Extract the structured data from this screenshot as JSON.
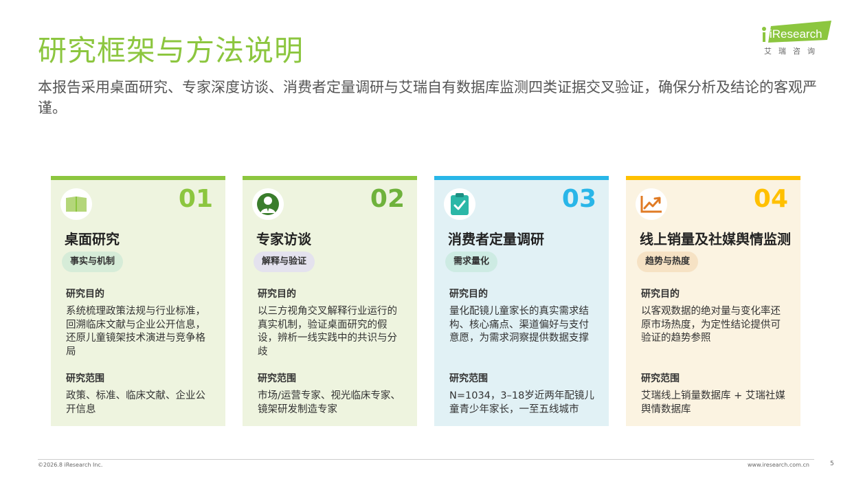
{
  "header": {
    "title": "研究框架与方法说明",
    "subtitle": "本报告采用桌面研究、专家深度访谈、消费者定量调研与艾瑞自有数据库监测四类证据交叉验证，确保分析及结论的客观严谨。"
  },
  "logo": {
    "brand_text": "iResearch",
    "cn_text": "艾瑞咨询",
    "color": "#8cc63f"
  },
  "cards": [
    {
      "number": "01",
      "title": "桌面研究",
      "tag": "事实与机制",
      "icon": "book-icon",
      "accent": "#8cc63f",
      "bg": "#eef4df",
      "tag_bg": "#d6ecd8",
      "purpose_label": "研究目的",
      "purpose": "系统梳理政策法规与行业标准，回溯临床文献与企业公开信息，还原儿童镜架技术演进与竞争格局",
      "scope_label": "研究范围",
      "scope": "政策、标准、临床文献、企业公开信息"
    },
    {
      "number": "02",
      "title": "专家访谈",
      "tag": "解释与验证",
      "icon": "expert-icon",
      "accent": "#6fb23c",
      "bg": "#eef4df",
      "tag_bg": "#e4e2ee",
      "purpose_label": "研究目的",
      "purpose": "以三方视角交叉解释行业运行的真实机制，验证桌面研究的假设，辨析一线实践中的共识与分歧",
      "scope_label": "研究范围",
      "scope": "市场/运营专家、视光临床专家、镜架研发制造专家"
    },
    {
      "number": "03",
      "title": "消费者定量调研",
      "tag": "需求量化",
      "icon": "clipboard-check-icon",
      "accent": "#29b6e8",
      "bg": "#e1f1f5",
      "tag_bg": "#cdebe3",
      "purpose_label": "研究目的",
      "purpose": "量化配镜儿童家长的真实需求结构、核心痛点、渠道偏好与支付意愿，为需求洞察提供数据支撑",
      "scope_label": "研究范围",
      "scope": "N=1034，3–18岁近两年配镜儿童青少年家长，一至五线城市"
    },
    {
      "number": "04",
      "title": "线上销量及社媒舆情监测",
      "tag": "趋势与热度",
      "icon": "trend-chart-icon",
      "accent": "#ffc000",
      "bg": "#fbf3e1",
      "tag_bg": "#f6e2c4",
      "purpose_label": "研究目的",
      "purpose": "以客观数据的绝对量与变化率还原市场热度，为定性结论提供可验证的趋势参照",
      "scope_label": "研究范围",
      "scope": "艾瑞线上销量数据库 + 艾瑞社媒舆情数据库"
    }
  ],
  "footer": {
    "copyright": "©2026.8 iResearch Inc.",
    "website": "www.iresearch.com.cn",
    "page": "5"
  }
}
